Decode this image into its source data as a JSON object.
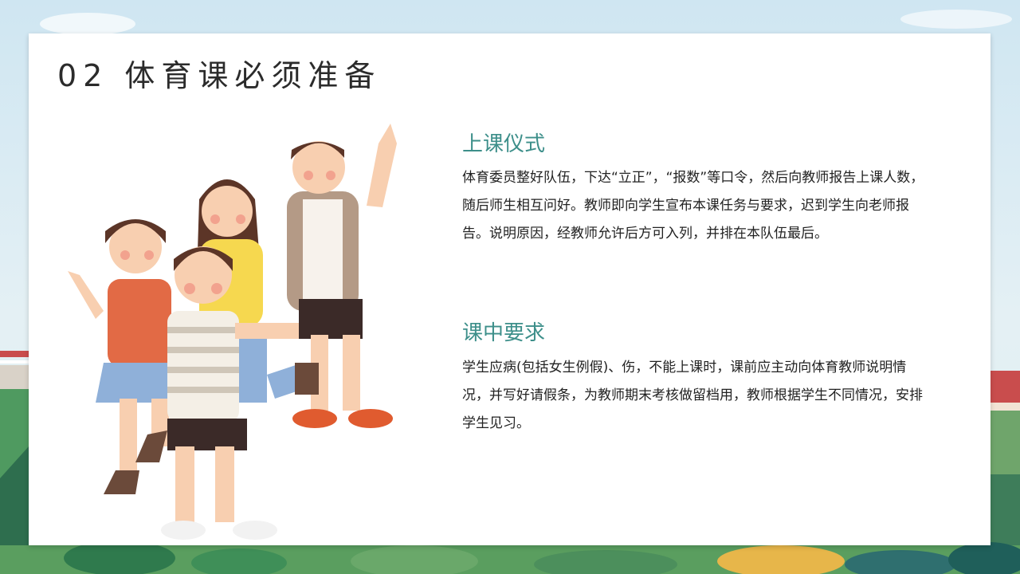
{
  "slide": {
    "title": "02  体育课必须准备"
  },
  "sections": [
    {
      "heading": "上课仪式",
      "body": "体育委员整好队伍，下达“立正”，“报数”等口令，然后向教师报告上课人数，随后师生相互问好。教师即向学生宣布本课任务与要求，迟到学生向老师报告。说明原因，经教师允许后方可入列，并排在本队伍最后。"
    },
    {
      "heading": "课中要求",
      "body": "学生应病(包括女生例假)、伤，不能上课时，课前应主动向体育教师说明情况，并写好请假条，为教师期末考核做留档用，教师根据学生不同情况，安排学生见习。"
    }
  ],
  "illustration": {
    "subject": "four-children-illustration"
  },
  "colors": {
    "heading": "#3d8f8a",
    "title": "#2b2b2b",
    "body_text": "#222222"
  }
}
